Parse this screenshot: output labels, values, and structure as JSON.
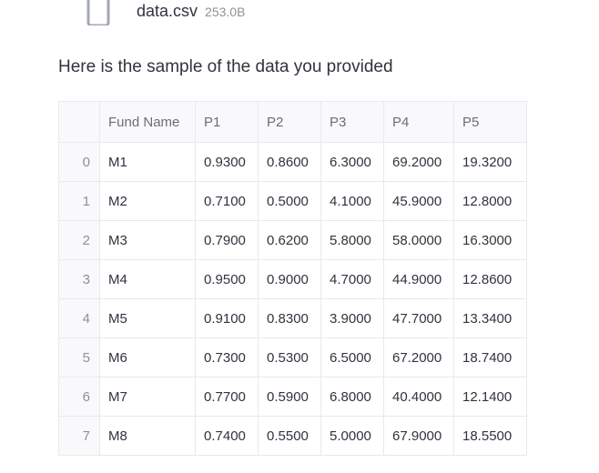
{
  "file": {
    "name": "data.csv",
    "size": "253.0B",
    "icon": "file-icon"
  },
  "intro_text": "Here is the sample of the data you provided",
  "table": {
    "columns": [
      "",
      "Fund Name",
      "P1",
      "P2",
      "P3",
      "P4",
      "P5"
    ],
    "rows": [
      [
        "0",
        "M1",
        "0.9300",
        "0.8600",
        "6.3000",
        "69.2000",
        "19.3200"
      ],
      [
        "1",
        "M2",
        "0.7100",
        "0.5000",
        "4.1000",
        "45.9000",
        "12.8000"
      ],
      [
        "2",
        "M3",
        "0.7900",
        "0.6200",
        "5.8000",
        "58.0000",
        "16.3000"
      ],
      [
        "3",
        "M4",
        "0.9500",
        "0.9000",
        "4.7000",
        "44.9000",
        "12.8600"
      ],
      [
        "4",
        "M5",
        "0.9100",
        "0.8300",
        "3.9000",
        "47.7000",
        "13.3400"
      ],
      [
        "5",
        "M6",
        "0.7300",
        "0.5300",
        "6.5000",
        "67.2000",
        "18.7400"
      ],
      [
        "6",
        "M7",
        "0.7700",
        "0.5900",
        "6.8000",
        "40.4000",
        "12.1400"
      ],
      [
        "7",
        "M8",
        "0.7400",
        "0.5500",
        "5.0000",
        "67.9000",
        "18.5500"
      ]
    ]
  }
}
